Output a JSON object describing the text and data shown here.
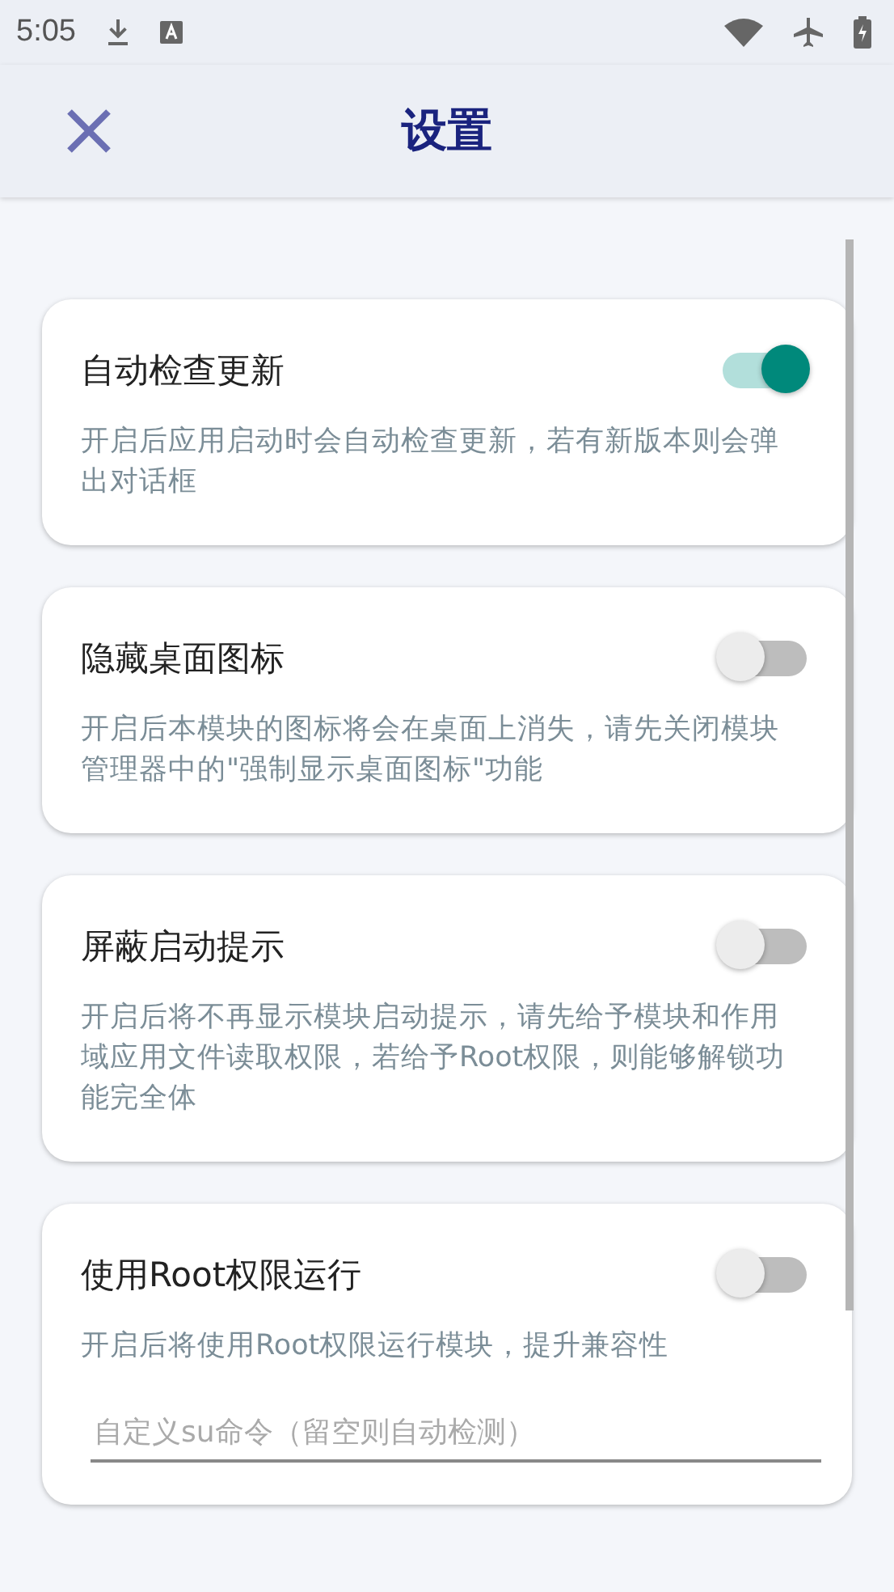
{
  "status_bar": {
    "time": "5:05"
  },
  "app_bar": {
    "title": "设置"
  },
  "settings": [
    {
      "kind": "toggle",
      "title": "自动检查更新",
      "description": "开启后应用启动时会自动检查更新，若有新版本则会弹出对话框",
      "on": true
    },
    {
      "kind": "toggle",
      "title": "隐藏桌面图标",
      "description": "开启后本模块的图标将会在桌面上消失，请先关闭模块管理器中的\"强制显示桌面图标\"功能",
      "on": false
    },
    {
      "kind": "toggle",
      "title": "屏蔽启动提示",
      "description": "开启后将不再显示模块启动提示，请先给予模块和作用域应用文件读取权限，若给予Root权限，则能够解锁功能完全体",
      "on": false
    },
    {
      "kind": "toggle_with_field",
      "title": "使用Root权限运行",
      "description": "开启后将使用Root权限运行模块，提升兼容性",
      "on": false,
      "field": {
        "placeholder": "自定义su命令（留空则自动检测）"
      }
    }
  ]
}
